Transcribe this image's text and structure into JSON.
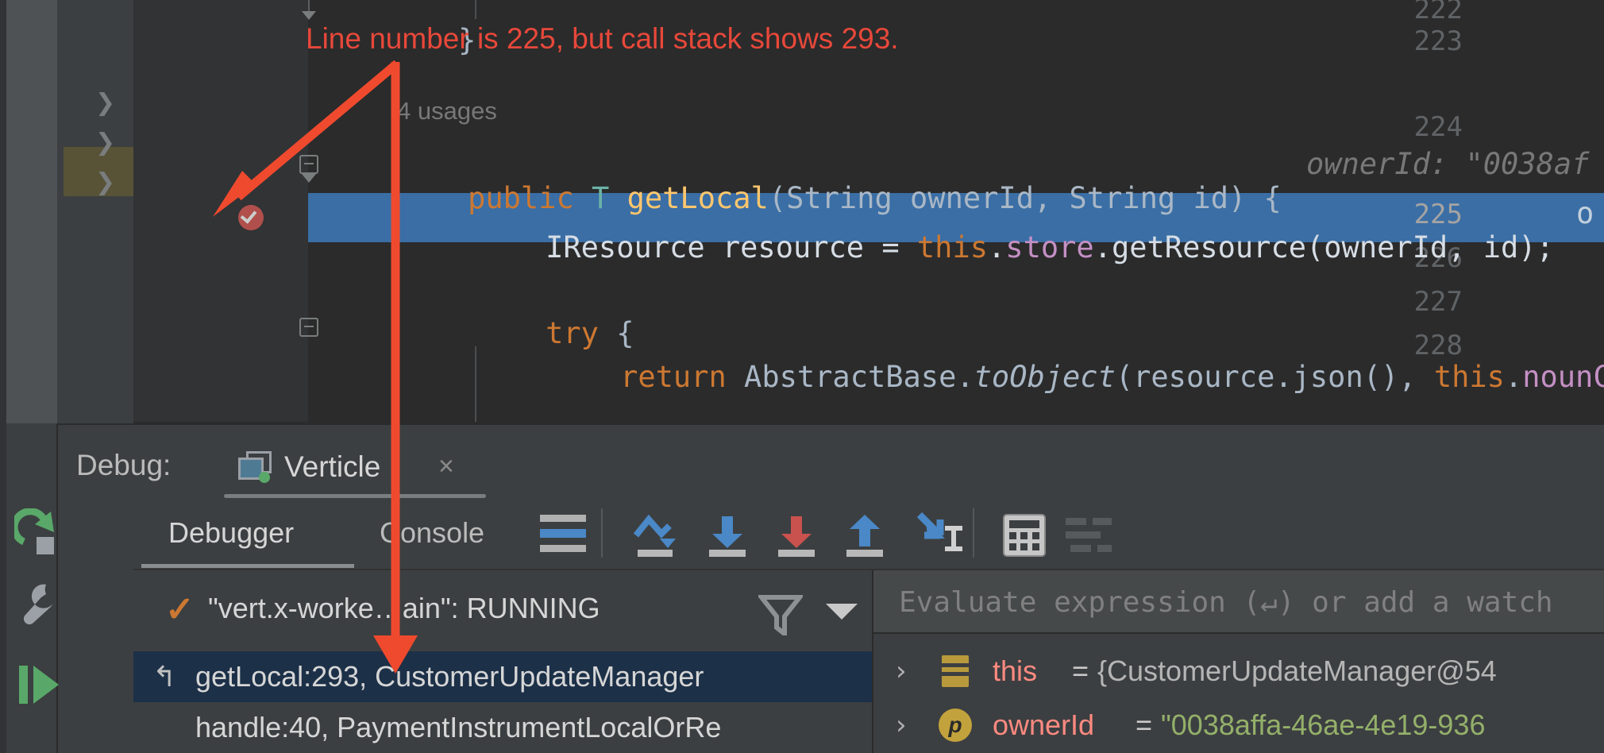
{
  "annotation": {
    "text": "Line number is 225, but call stack shows 293.",
    "color": "#e8483a"
  },
  "editor": {
    "lines": [
      {
        "number": "222",
        "text": "}",
        "partial": true
      },
      {
        "number": "223",
        "text": ""
      },
      {
        "number": "224",
        "text": "public T getLocal(String ownerId, String id) {",
        "hint": "ownerId: \"0038af",
        "usages": "4 usages"
      },
      {
        "number": "225",
        "text": "IResource resource = this.store.getResource(ownerId, id);",
        "hint": "o",
        "selected": true,
        "breakpoint": true
      },
      {
        "number": "226",
        "text": ""
      },
      {
        "number": "227",
        "text": "try {"
      },
      {
        "number": "228",
        "text": "return AbstractBase.toObject(resource.json(), this.nounC"
      }
    ],
    "code_224_parts": {
      "kw": "public",
      "type": "T",
      "fn": "getLocal",
      "params": "(String ownerId, String id) {"
    },
    "code_225_parts": {
      "type": "IResource",
      "var": " resource = ",
      "this": "this",
      "dot": ".",
      "field": "store",
      "call": ".getResource(ownerId, id);"
    },
    "code_227_parts": {
      "kw": "try",
      "rest": " {"
    },
    "code_228_parts": {
      "kw": "return",
      "cls": " AbstractBase.",
      "method": "toObject",
      "args": "(resource.json(), ",
      "this": "this",
      "dot": ".",
      "field": "nounC"
    },
    "colors": {
      "background": "#2b2b2b",
      "gutter": "#313335",
      "selection": "#3a6ea5",
      "keyword": "#cc7832",
      "string": "#6a8759",
      "method": "#ffc66d",
      "field": "#c490c4",
      "type": "#6bb2a6",
      "text": "#a9b7c6",
      "comment": "#787878"
    }
  },
  "debug_window": {
    "title_label": "Debug:",
    "tab": {
      "label": "Verticle",
      "close_label": "×",
      "running": true
    },
    "tabs": [
      {
        "label": "Debugger",
        "active": true
      },
      {
        "label": "Console",
        "active": false
      }
    ],
    "toolbar_icons": [
      {
        "name": "show-execution-point-icon",
        "tooltip": "Show Execution Point"
      },
      {
        "name": "step-over-icon",
        "tooltip": "Step Over"
      },
      {
        "name": "step-into-icon",
        "tooltip": "Step Into"
      },
      {
        "name": "force-step-into-icon",
        "tooltip": "Force Step Into"
      },
      {
        "name": "step-out-icon",
        "tooltip": "Step Out"
      },
      {
        "name": "run-to-cursor-icon",
        "tooltip": "Run to Cursor"
      },
      {
        "name": "evaluate-expression-icon",
        "tooltip": "Evaluate Expression"
      },
      {
        "name": "sort-values-icon",
        "tooltip": "Sort Values",
        "disabled": true
      }
    ],
    "rail_icons": [
      {
        "name": "rerun-icon",
        "tooltip": "Rerun"
      },
      {
        "name": "settings-wrench-icon",
        "tooltip": "Settings"
      },
      {
        "name": "resume-program-icon",
        "tooltip": "Resume Program"
      }
    ],
    "frames": {
      "thread_label": "\"vert.x-worke…ain\": RUNNING",
      "filter_icon": "funnel-icon",
      "dropdown_icon": "chevron-down-icon",
      "items": [
        {
          "label": "getLocal:293, CustomerUpdateManager",
          "selected": true,
          "icon": "return-arrow-icon"
        },
        {
          "label": "handle:40, PaymentInstrumentLocalOrRe",
          "selected": false,
          "icon": ""
        }
      ]
    },
    "variables": {
      "evaluate_placeholder": "Evaluate expression (↵) or add a watch",
      "items": [
        {
          "expand": "›",
          "badge": "object",
          "name": "this",
          "eq": "=",
          "value": "{CustomerUpdateManager@54",
          "is_string": false
        },
        {
          "expand": "›",
          "badge": "p",
          "name": "ownerId",
          "eq": "=",
          "value": "\"0038affa-46ae-4e19-936",
          "is_string": true
        }
      ]
    }
  }
}
